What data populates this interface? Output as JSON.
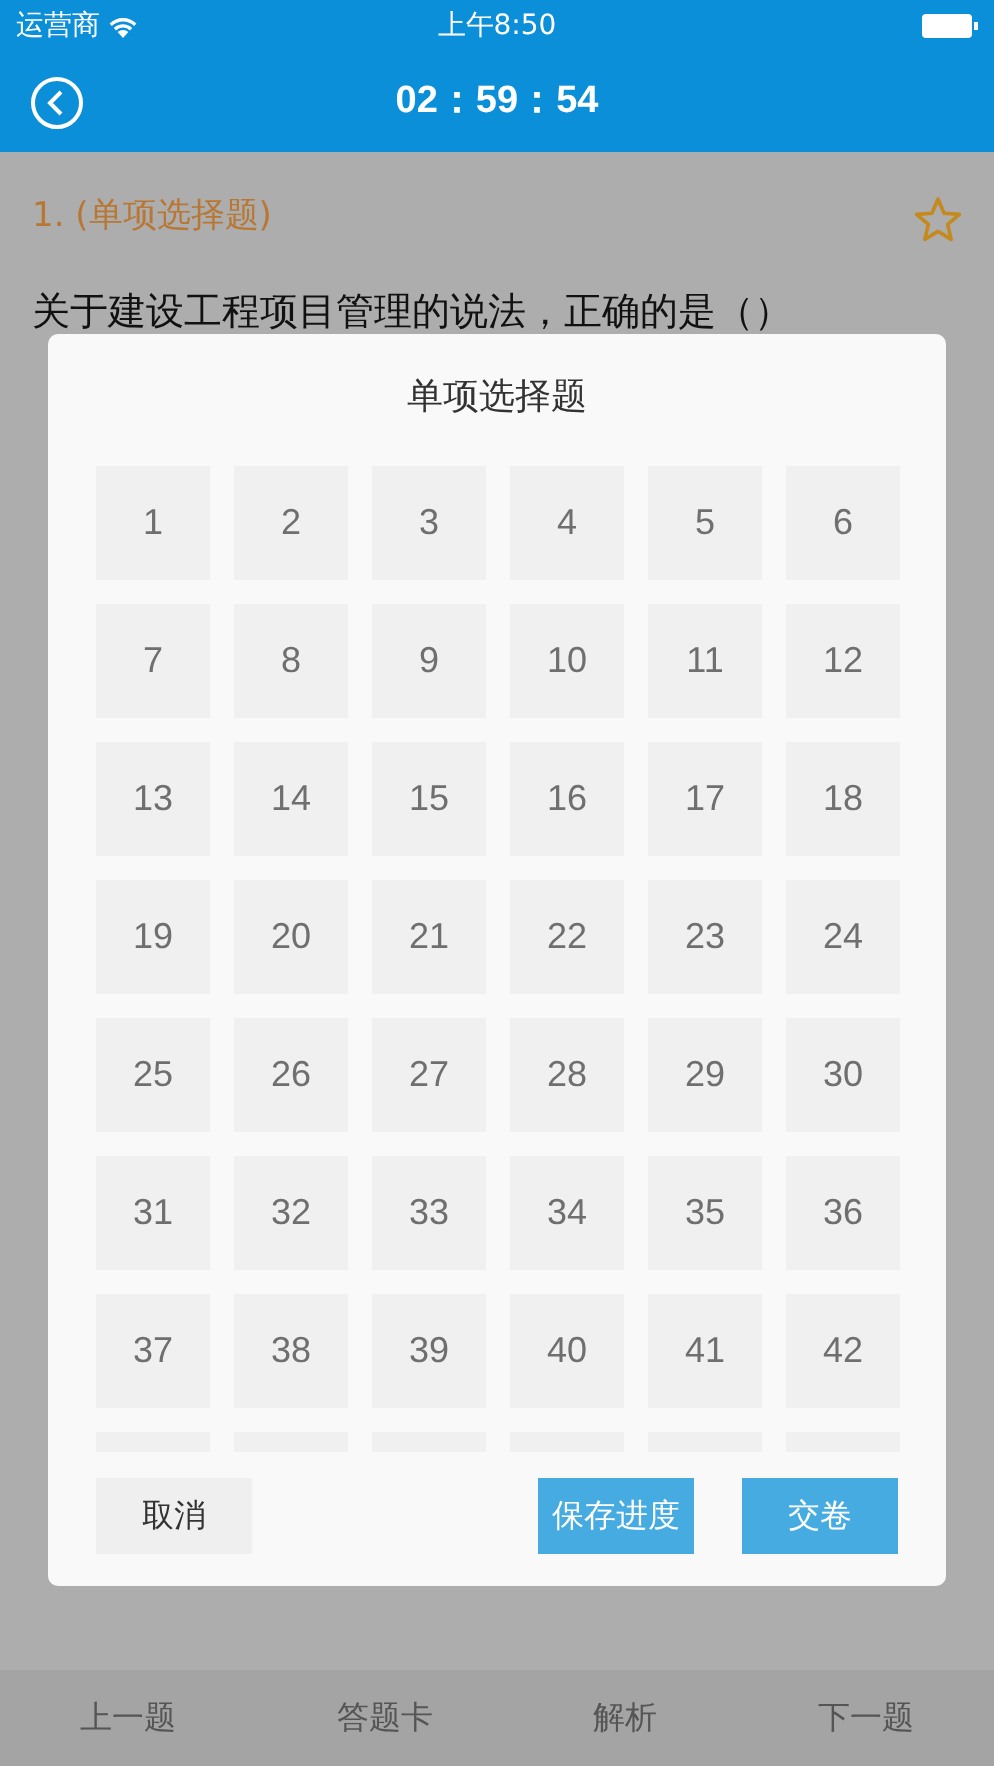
{
  "status_bar": {
    "carrier": "运营商",
    "time": "上午8:50"
  },
  "header": {
    "timer": "02：59：54"
  },
  "question": {
    "label": "1. (单项选择题)",
    "starred": false,
    "text": "关于建设工程项目管理的说法，正确的是（）"
  },
  "answer_sheet": {
    "title": "单项选择题",
    "cells": [
      "1",
      "2",
      "3",
      "4",
      "5",
      "6",
      "7",
      "8",
      "9",
      "10",
      "11",
      "12",
      "13",
      "14",
      "15",
      "16",
      "17",
      "18",
      "19",
      "20",
      "21",
      "22",
      "23",
      "24",
      "25",
      "26",
      "27",
      "28",
      "29",
      "30",
      "31",
      "32",
      "33",
      "34",
      "35",
      "36",
      "37",
      "38",
      "39",
      "40",
      "41",
      "42"
    ],
    "buttons": [
      {
        "label": "取消",
        "kind": "secondary"
      },
      {
        "label": "保存进度",
        "kind": "primary"
      },
      {
        "label": "交卷",
        "kind": "primary"
      }
    ]
  },
  "bottom_nav": [
    "上一题",
    "答题卡",
    "解析",
    "下一题"
  ]
}
